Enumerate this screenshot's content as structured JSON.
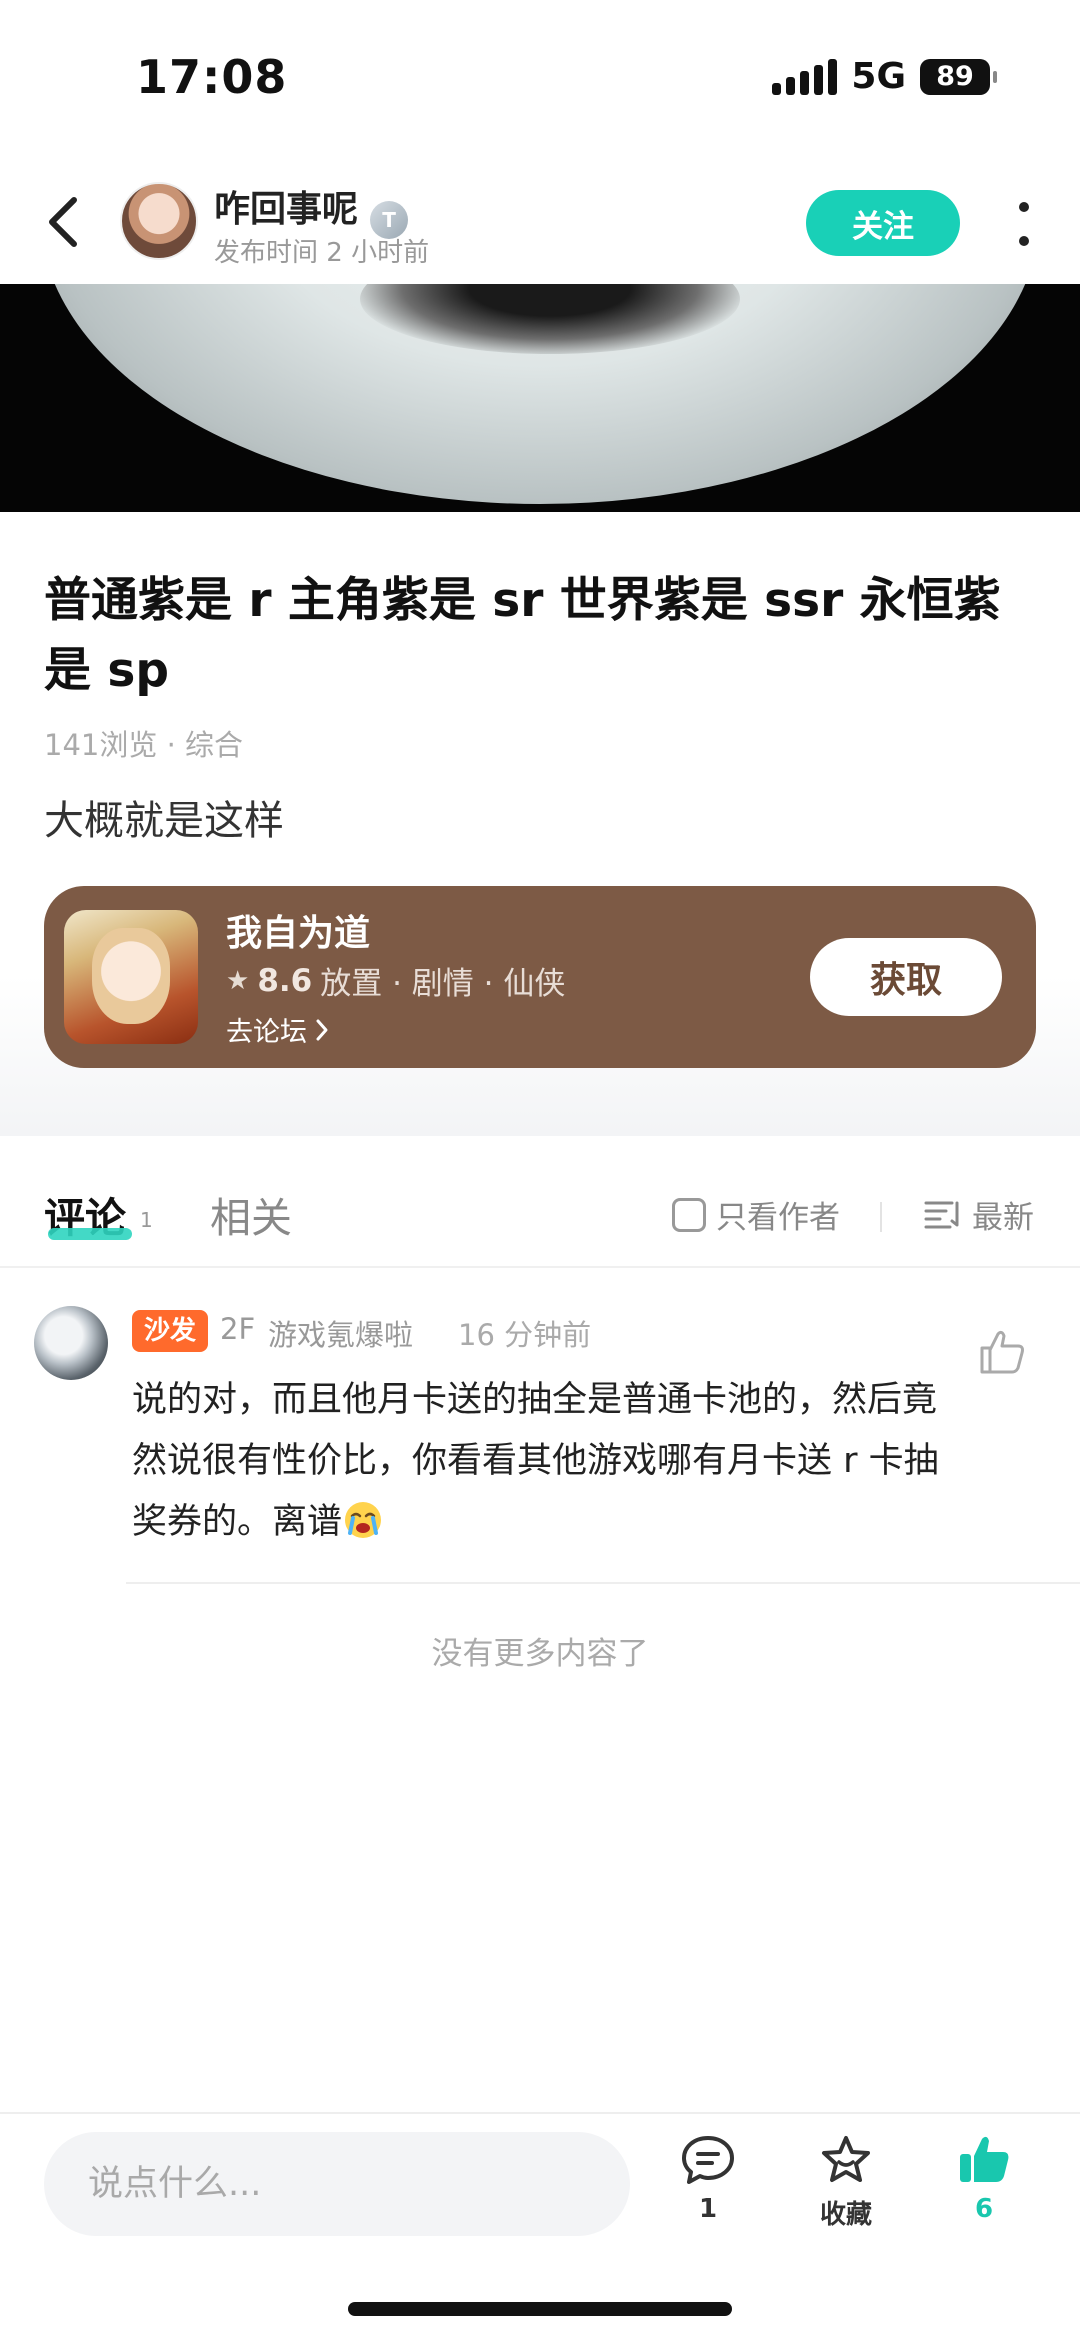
{
  "status_bar": {
    "time": "17:08",
    "network": "5G",
    "battery": "89"
  },
  "header": {
    "author_name": "咋回事呢",
    "level_badge": "T",
    "post_time": "发布时间 2 小时前",
    "follow_label": "关注"
  },
  "post": {
    "title": "普通紫是 r 主角紫是 sr 世界紫是 ssr 永恒紫是 sp",
    "meta": "141浏览 · 综合",
    "body": "大概就是这样"
  },
  "game_card": {
    "name": "我自为道",
    "rating": "8.6",
    "tags": "放置 · 剧情 · 仙侠",
    "forum_link": "去论坛",
    "get_label": "获取",
    "background_color": "#7d5a45"
  },
  "tabs": {
    "comments_label": "评论",
    "comments_count": "1",
    "related_label": "相关",
    "author_only_label": "只看作者",
    "sort_label": "最新"
  },
  "comment": {
    "badge": "沙发",
    "floor": "2F",
    "username": "游戏氪爆啦",
    "time": "16 分钟前",
    "text": "说的对，而且他月卡送的抽全是普通卡池的，然后竟然说很有性价比，你看看其他游戏哪有月卡送 r 卡抽奖券的。离谱"
  },
  "no_more_text": "没有更多内容了",
  "bottom_bar": {
    "input_placeholder": "说点什么...",
    "comment_count": "1",
    "favorite_label": "收藏",
    "like_count": "6"
  },
  "colors": {
    "accent": "#19d0b7",
    "sofa_badge": "#ff6a2c"
  },
  "icons": [
    "back-arrow-icon",
    "more-vertical-icon",
    "star-icon",
    "chevron-right-icon",
    "checkbox-icon",
    "sort-list-icon",
    "thumbs-up-outline-icon",
    "crying-emoji-icon",
    "comment-bubble-icon",
    "favorite-star-icon",
    "thumbs-up-filled-icon"
  ]
}
